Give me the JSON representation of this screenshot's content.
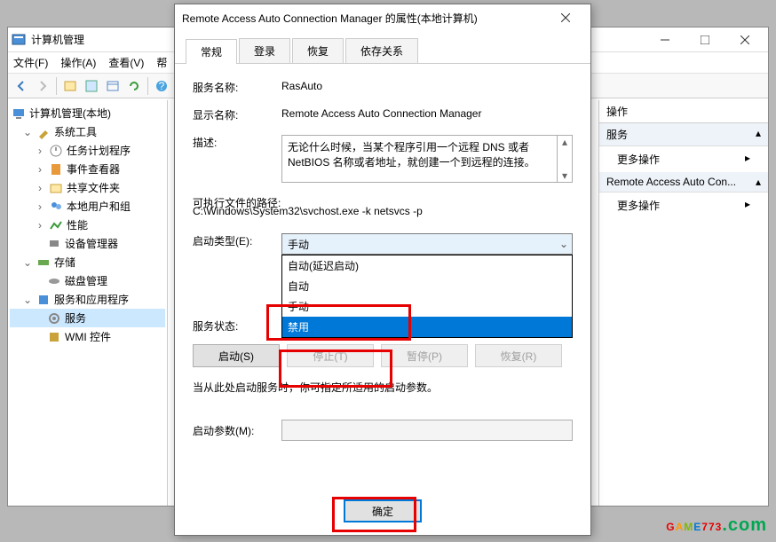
{
  "main_window": {
    "title": "计算机管理",
    "menu": {
      "file": "文件(F)",
      "action": "操作(A)",
      "view": "查看(V)",
      "help": "帮"
    }
  },
  "tree": {
    "root": "计算机管理(本地)",
    "sys_tools": "系统工具",
    "task_sched": "任务计划程序",
    "event_viewer": "事件查看器",
    "shared": "共享文件夹",
    "users": "本地用户和组",
    "perf": "性能",
    "devmgr": "设备管理器",
    "storage": "存储",
    "diskmgr": "磁盘管理",
    "svc_apps": "服务和应用程序",
    "services": "服务",
    "wmi": "WMI 控件"
  },
  "actions": {
    "header": "操作",
    "section1": "服务",
    "more1": "更多操作",
    "section2": "Remote Access Auto Con...",
    "more2": "更多操作"
  },
  "dialog": {
    "title": "Remote Access Auto Connection Manager 的属性(本地计算机)",
    "tabs": {
      "general": "常规",
      "logon": "登录",
      "recovery": "恢复",
      "deps": "依存关系"
    },
    "labels": {
      "svc_name": "服务名称:",
      "disp_name": "显示名称:",
      "desc": "描述:",
      "exe_path": "可执行文件的路径:",
      "startup": "启动类型(E):",
      "status": "服务状态:",
      "param": "启动参数(M):"
    },
    "values": {
      "svc_name": "RasAuto",
      "disp_name": "Remote Access Auto Connection Manager",
      "desc": "无论什么时候，当某个程序引用一个远程 DNS 或者 NetBIOS 名称或者地址，就创建一个到远程的连接。",
      "exe_path": "C:\\Windows\\System32\\svchost.exe -k netsvcs -p",
      "startup_selected": "手动",
      "status": ""
    },
    "dropdown": {
      "auto_delayed": "自动(延迟启动)",
      "auto": "自动",
      "manual": "手动",
      "disabled": "禁用"
    },
    "buttons": {
      "start": "启动(S)",
      "stop": "停止(T)",
      "pause": "暂停(P)",
      "resume": "恢复(R)",
      "ok": "确定"
    },
    "hint": "当从此处启动服务时，你可指定所适用的启动参数。"
  },
  "watermark": {
    "text": "GAME773",
    "suffix": ".com"
  }
}
